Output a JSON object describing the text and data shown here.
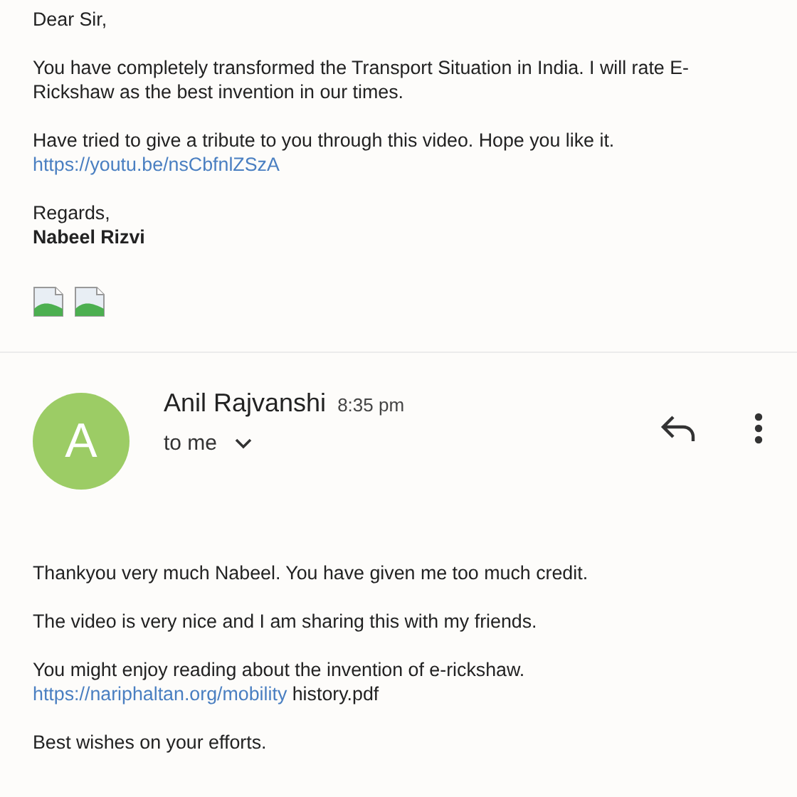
{
  "previous_message": {
    "paragraphs": [
      {
        "lines": [
          [
            {
              "kind": "plain",
              "text": "Dear Sir,"
            }
          ]
        ]
      },
      {
        "lines": [
          [
            {
              "kind": "plain",
              "text": "You have completely transformed the Transport Situation in India. I will rate E-"
            }
          ],
          [
            {
              "kind": "plain",
              "text": "Rickshaw as the best invention in our times."
            }
          ]
        ]
      },
      {
        "lines": [
          [
            {
              "kind": "plain",
              "text": "Have tried to give a tribute to you through this video. Hope you like it."
            }
          ],
          [
            {
              "kind": "link",
              "text": "https://youtu.be/nsCbfnlZSzA"
            }
          ]
        ]
      },
      {
        "lines": [
          [
            {
              "kind": "plain",
              "text": "Regards,"
            }
          ],
          [
            {
              "kind": "bold",
              "text": "Nabeel Rizvi"
            }
          ]
        ]
      }
    ]
  },
  "message": {
    "avatar_letter": "A",
    "sender": "Anil Rajvanshi",
    "time": "8:35 pm",
    "recipient": "to me",
    "paragraphs": [
      {
        "lines": [
          [
            {
              "kind": "plain",
              "text": "Thankyou very much Nabeel. You have given me too much credit."
            }
          ]
        ]
      },
      {
        "lines": [
          [
            {
              "kind": "plain",
              "text": "The video is very nice and I am sharing this with my friends."
            }
          ]
        ]
      },
      {
        "lines": [
          [
            {
              "kind": "plain",
              "text": "You might enjoy reading about the invention of e-rickshaw."
            }
          ],
          [
            {
              "kind": "link",
              "text": "https://nariphaltan.org/mobility"
            },
            {
              "kind": "plain",
              "text": " history.pdf"
            }
          ]
        ]
      },
      {
        "lines": [
          [
            {
              "kind": "plain",
              "text": "Best wishes on your efforts."
            }
          ]
        ]
      }
    ]
  }
}
